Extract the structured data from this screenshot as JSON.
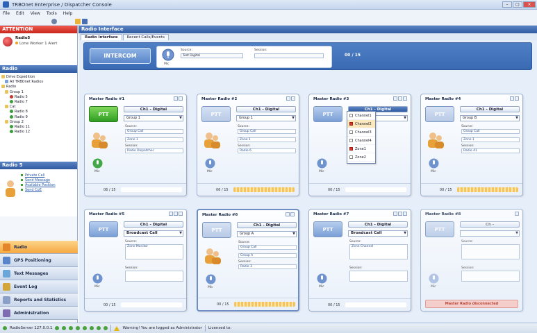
{
  "window": {
    "title": "TRBOnet Enterprise / Dispatcher Console"
  },
  "menu": [
    "File",
    "Edit",
    "View",
    "Tools",
    "Help"
  ],
  "attention": {
    "header": "ATTENTION",
    "radio_name": "Radio5",
    "status": "Lone Worker 1 Alert"
  },
  "radio_tree": {
    "header": "Radio",
    "items": [
      "Drive Expedition",
      "All TRBOnet Radios",
      "Radio",
      "Group 1",
      "Radio 5",
      "Radio 7",
      "Cat",
      "Radio 8",
      "Radio 9",
      "Group 2",
      "Radio 11",
      "Radio 12"
    ]
  },
  "radio_detail": {
    "header": "Radio 5",
    "actions": [
      "Private Call",
      "Send Message",
      "Available Position",
      "Send CoE"
    ]
  },
  "nav": [
    {
      "label": "Radio",
      "active": true
    },
    {
      "label": "GPS Positioning"
    },
    {
      "label": "Text Messages"
    },
    {
      "label": "Event Log"
    },
    {
      "label": "Reports and Statistics"
    },
    {
      "label": "Administration"
    }
  ],
  "main": {
    "header": "Radio Interface",
    "tabs": [
      "Radio Interface",
      "Recent Calls/Events"
    ],
    "intercom_label": "INTERCOM",
    "mic_label": "Mic",
    "source_label": "Source:",
    "source_value": "Test Digital",
    "session_label": "Session:",
    "session_value": "",
    "volume": "00 / 15"
  },
  "cards": [
    {
      "title": "Master Radio #1",
      "channel": "Ch1 - Digital",
      "select": "Group 1",
      "ptt": "PTT",
      "source_label": "Source:",
      "source": "Group Call",
      "group": "Zone 1",
      "session_label": "Session:",
      "session": "Radio Dispatcher",
      "mic": "Mic",
      "volume": "06 / 15"
    },
    {
      "title": "Master Radio #2",
      "channel": "Ch1 - Digital",
      "select": "Group 1",
      "ptt": "PTT",
      "source_label": "Source:",
      "source": "Group Call",
      "group": "Zone 1",
      "session_label": "Session:",
      "session": "Radio 6",
      "mic": "Mic",
      "volume": "06 / 15"
    },
    {
      "title": "Master Radio #3",
      "channel": "Ch1 - Digital",
      "select": "",
      "ptt": "PTT",
      "mic": "Mic",
      "volume": "00 / 15",
      "dropdown": [
        {
          "label": "Channel1",
          "checked": false
        },
        {
          "label": "Channel2",
          "checked": true
        },
        {
          "label": "Channel3",
          "checked": false
        },
        {
          "label": "Channel4",
          "checked": false
        },
        {
          "label": "Zone1",
          "checked": true
        },
        {
          "label": "Zone2",
          "checked": false
        }
      ]
    },
    {
      "title": "Master Radio #4",
      "channel": "Ch1 - Digital",
      "select": "Group B",
      "ptt": "PTT",
      "source_label": "Source:",
      "source": "Group Call",
      "group": "Zone 1",
      "session_label": "Session:",
      "session": "Radio 41",
      "mic": "Mic",
      "volume": "00 / 15"
    },
    {
      "title": "Master Radio #5",
      "channel": "Ch1 - Digital",
      "select": "Broadcast Call",
      "ptt": "PTT",
      "source_label": "Source:",
      "source": "Zone Monitor",
      "session_label": "Session:",
      "session": "",
      "mic": "Mic",
      "volume": "00 / 15"
    },
    {
      "title": "Master Radio #6",
      "channel": "Ch1 - Digital",
      "select": "Group A",
      "ptt": "PTT",
      "source_label": "Source:",
      "source": "Group Call",
      "group": "Group A",
      "session_label": "Session:",
      "session": "Radio 3",
      "mic": "Mic",
      "volume": "00 / 15"
    },
    {
      "title": "Master Radio #7",
      "channel": "Ch1 - Digital",
      "select": "Broadcast Call",
      "ptt": "PTT",
      "source_label": "Source:",
      "source": "Zone Channel",
      "session_label": "Session:",
      "session": "",
      "mic": "Mic",
      "volume": "00 / 15"
    },
    {
      "title": "Master Radio #8",
      "channel": "Ch -",
      "select": "",
      "ptt": "PTT",
      "source_label": "Source:",
      "session_label": "Session:",
      "mic": "Mic",
      "unavailable": "Master Radio disconnected"
    }
  ],
  "status": {
    "server": "RadioServer 127.0.0.1",
    "warning": "Warning! You are logged as Administrator",
    "user": "Licensed to:"
  },
  "colors": {
    "accent": "#2f5aa1",
    "attention": "#c8261c",
    "ptt_active": "#2f9d22",
    "nav_active": "#f5a742"
  }
}
